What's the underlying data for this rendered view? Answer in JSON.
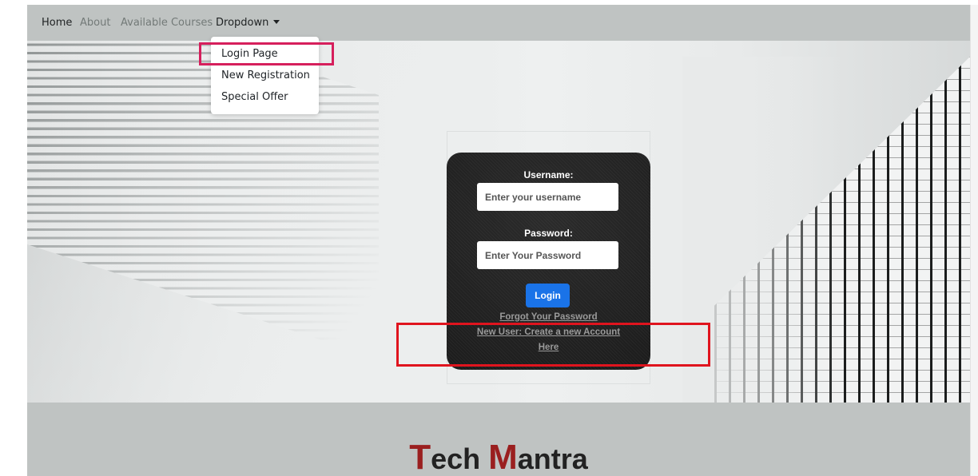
{
  "nav": {
    "home": "Home",
    "about": "About",
    "courses": "Available Courses",
    "dropdown": "Dropdown"
  },
  "dropdown_menu": {
    "items": [
      "Login Page",
      "New Registration",
      "Special Offer"
    ]
  },
  "login": {
    "username_label": "Username:",
    "username_placeholder": "Enter your username",
    "password_label": "Password:",
    "password_placeholder": "Enter Your Password",
    "login_button": "Login",
    "forgot_link": "Forgot Your Password",
    "new_user_line1": "New User: Create a new Account",
    "new_user_line2": "Here"
  },
  "footer": {
    "brand_first_cap": "T",
    "brand_first_rest": "ech ",
    "brand_second_cap": "M",
    "brand_second_rest": "antra"
  },
  "colors": {
    "navbar_bg": "#bfc3c2",
    "login_button": "#1a73e8",
    "highlight_pink": "#d61f5c",
    "highlight_red": "#e0141e",
    "brand_accent": "#9a1f1f"
  }
}
